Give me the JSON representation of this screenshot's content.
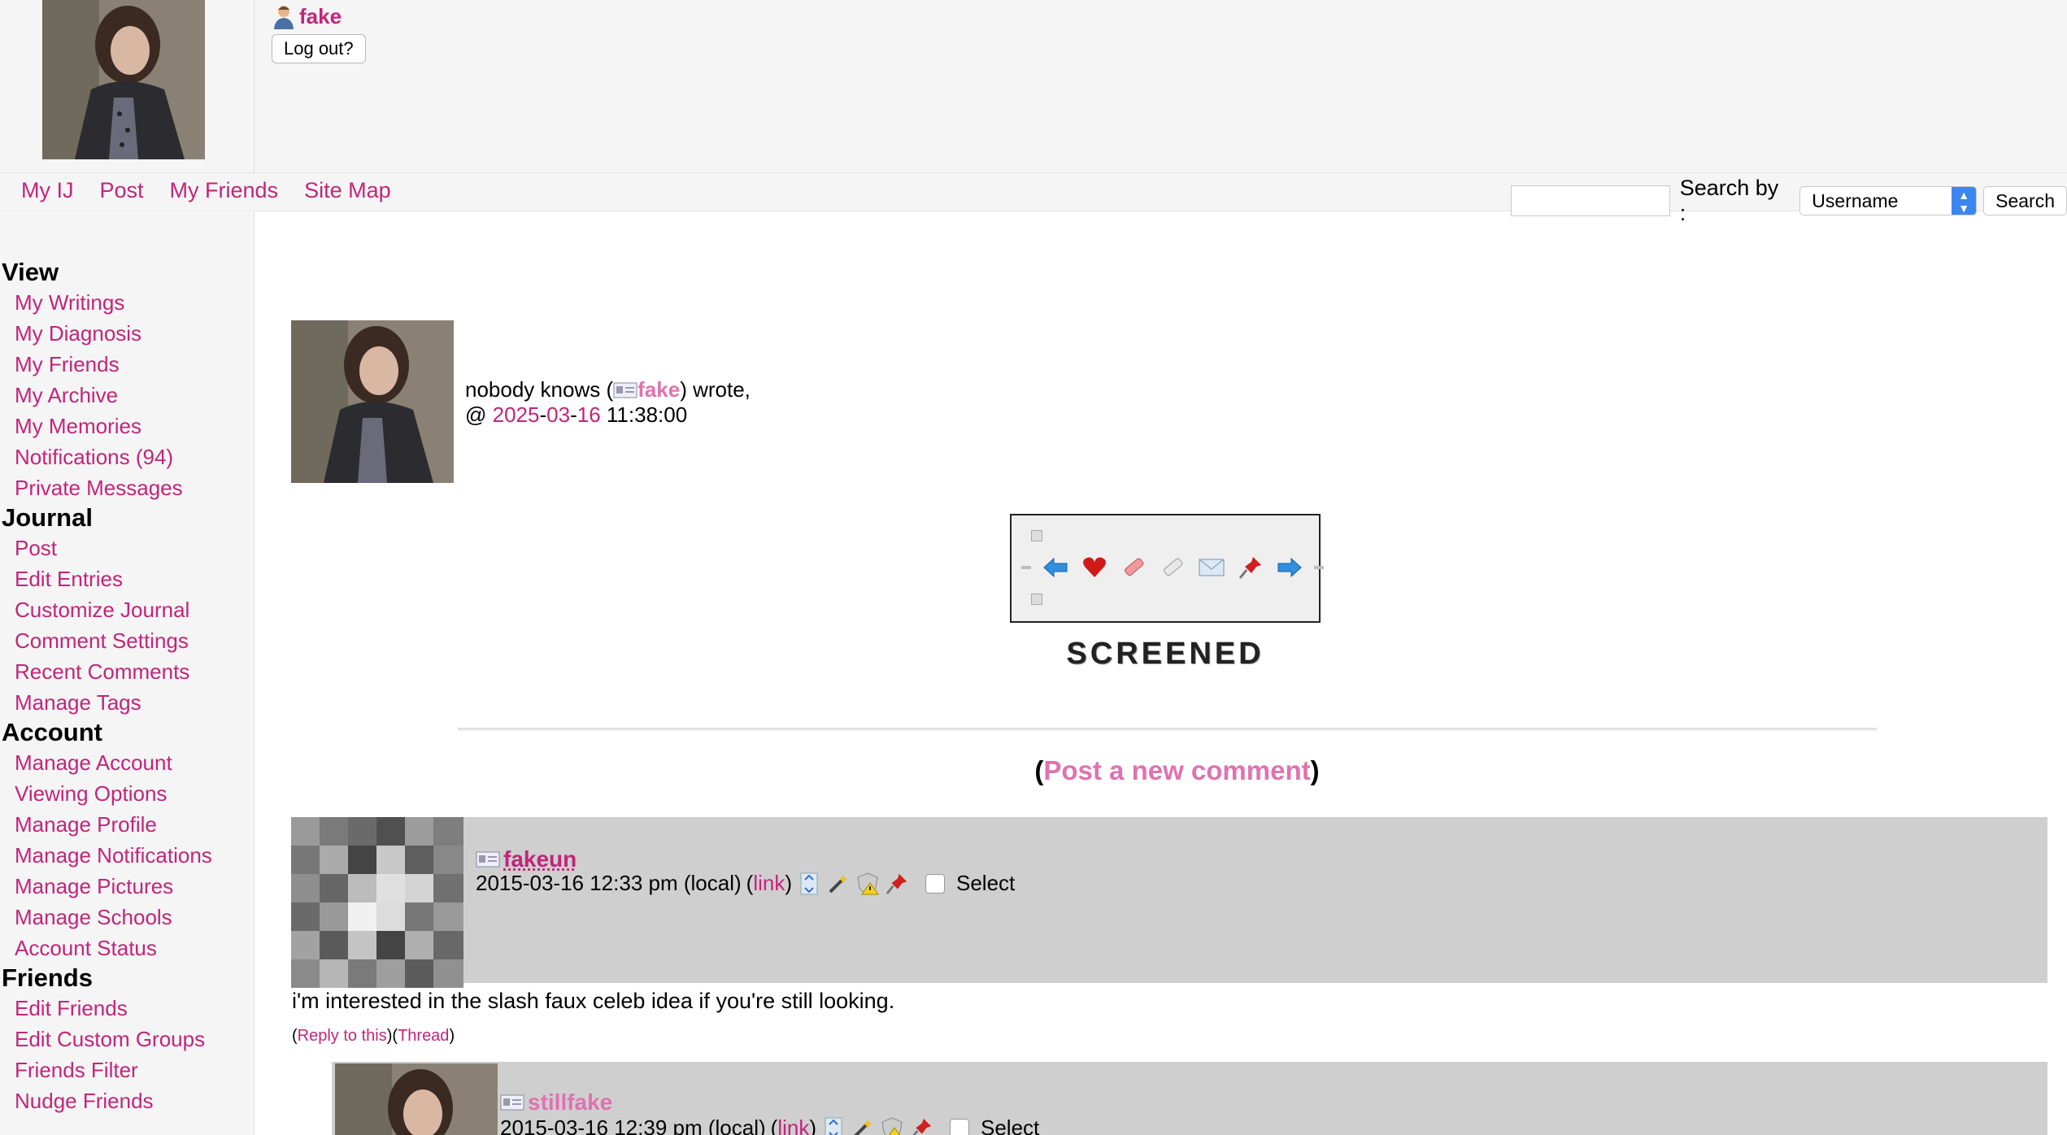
{
  "header": {
    "username": "fake",
    "logout_label": "Log out?"
  },
  "nav": {
    "links": [
      "My IJ",
      "Post",
      "My Friends",
      "Site Map"
    ],
    "search_label": "Search by :",
    "search_select_value": "Username",
    "search_button": "Search",
    "search_value": ""
  },
  "sidebar": {
    "sections": [
      {
        "heading": "View",
        "items": [
          "My Writings",
          "My Diagnosis",
          "My Friends",
          "My Archive",
          "My Memories",
          "Notifications (94)",
          "Private Messages"
        ]
      },
      {
        "heading": "Journal",
        "items": [
          "Post",
          "Edit Entries",
          "Customize Journal",
          "Comment Settings",
          "Recent Comments",
          "Manage Tags"
        ]
      },
      {
        "heading": "Account",
        "items": [
          "Manage Account",
          "Viewing Options",
          "Manage Profile",
          "Manage Notifications",
          "Manage Pictures",
          "Manage Schools",
          "Account Status"
        ]
      },
      {
        "heading": "Friends",
        "items": [
          "Edit Friends",
          "Edit Custom Groups",
          "Friends Filter",
          "Nudge Friends"
        ]
      }
    ]
  },
  "entry": {
    "author_name": "nobody knows",
    "author_user": "fake",
    "wrote": "wrote,",
    "date_year": "2025",
    "date_month": "03",
    "date_day": "16",
    "time": "11:38:00",
    "screened_label": "SCREENED",
    "post_new_comment": "Post a new comment"
  },
  "comments": [
    {
      "user": "fakeun",
      "date": "2015-03-16 12:33 pm (local)",
      "link_label": "link",
      "select_label": "Select",
      "body": "i'm interested in the slash faux celeb idea if you're still looking.",
      "reply_label": "Reply to this",
      "thread_label": "Thread"
    },
    {
      "user": "stillfake",
      "date": "2015-03-16 12:39 pm (local)",
      "link_label": "link",
      "select_label": "Select"
    }
  ],
  "colors": {
    "link": "#c2257a",
    "post_new_link": "#e072b0",
    "comment_bg": "#cfcfcf",
    "sidebar_bg": "#f5f5f5"
  }
}
